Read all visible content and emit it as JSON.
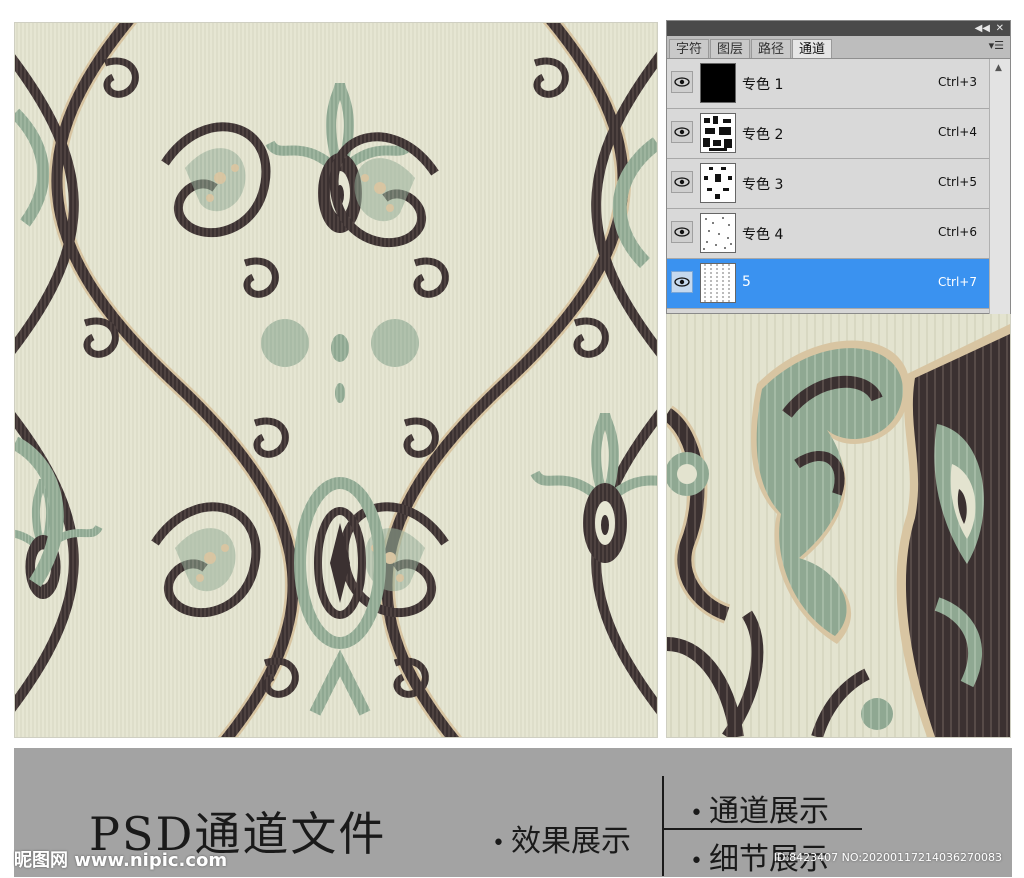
{
  "colors": {
    "background_cream": "#e5e5d2",
    "dark_brown": "#3b3131",
    "sage_green": "#8fa892",
    "tan": "#d8c5a2",
    "selection_blue": "#3a92f0",
    "banner_gray": "#a3a3a3"
  },
  "panel": {
    "tabs": [
      {
        "label": "字符",
        "active": false
      },
      {
        "label": "图层",
        "active": false
      },
      {
        "label": "路径",
        "active": false
      },
      {
        "label": "通道",
        "active": true
      }
    ],
    "icons": {
      "collapse": "double-chevron-left-icon",
      "close": "close-icon",
      "menu": "panel-menu-icon"
    },
    "channels": [
      {
        "name": "专色 1",
        "shortcut": "Ctrl+3",
        "selected": false,
        "visible": true
      },
      {
        "name": "专色 2",
        "shortcut": "Ctrl+4",
        "selected": false,
        "visible": true
      },
      {
        "name": "专色 3",
        "shortcut": "Ctrl+5",
        "selected": false,
        "visible": true
      },
      {
        "name": "专色 4",
        "shortcut": "Ctrl+6",
        "selected": false,
        "visible": true
      },
      {
        "name": "5",
        "shortcut": "Ctrl+7",
        "selected": true,
        "visible": true
      }
    ]
  },
  "banner": {
    "title": "PSD通道文件",
    "effect_label": "效果展示",
    "channel_label": "通道展示",
    "detail_label": "细节展示",
    "bullet": "•",
    "watermark_logo": "昵图网 www.nipic.com",
    "watermark_id": "ID:8423407 NO:20200117214036270083"
  }
}
